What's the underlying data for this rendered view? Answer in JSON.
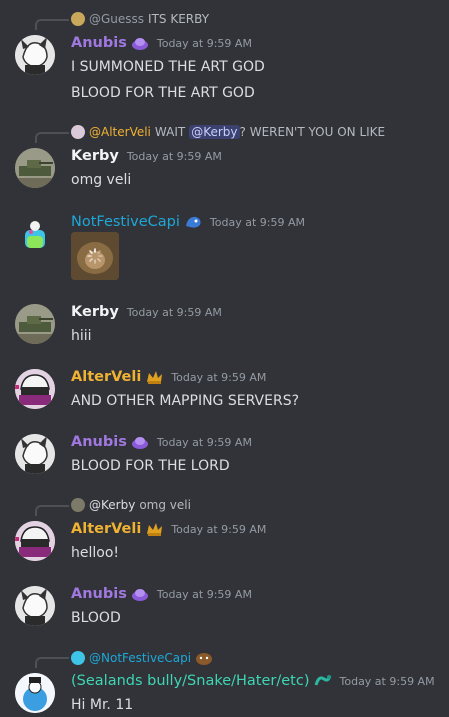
{
  "messages": [
    {
      "reply_name": "@Guesss",
      "reply_text": "ITS KERBY",
      "author": "Anubis",
      "author_color": "#a078e0",
      "timestamp": "Today at 9:59 AM",
      "lines": [
        "I SUMMONED THE ART GOD",
        "BLOOD FOR THE ART GOD"
      ]
    },
    {
      "reply_name": "@AlterVeli",
      "reply_text_before": "WAIT",
      "reply_mention": "@Kerby",
      "reply_text_after": "? WEREN'T YOU ON LIKE",
      "author": "Kerby",
      "author_color": "#f2f3f5",
      "timestamp": "Today at 9:59 AM",
      "lines": [
        "omg veli"
      ]
    },
    {
      "author": "NotFestiveCapi",
      "author_color": "#1ea7d8",
      "timestamp": "Today at 9:59 AM"
    },
    {
      "author": "Kerby",
      "author_color": "#f2f3f5",
      "timestamp": "Today at 9:59 AM",
      "lines": [
        "hiii"
      ]
    },
    {
      "author": "AlterVeli",
      "author_color": "#f0b232",
      "timestamp": "Today at 9:59 AM",
      "lines": [
        "AND OTHER MAPPING SERVERS?"
      ]
    },
    {
      "author": "Anubis",
      "author_color": "#a078e0",
      "timestamp": "Today at 9:59 AM",
      "lines": [
        "BLOOD FOR THE LORD"
      ]
    },
    {
      "reply_name": "@Kerby",
      "reply_text": "omg veli",
      "author": "AlterVeli",
      "author_color": "#f0b232",
      "timestamp": "Today at 9:59 AM",
      "lines": [
        "helloo!"
      ]
    },
    {
      "author": "Anubis",
      "author_color": "#a078e0",
      "timestamp": "Today at 9:59 AM",
      "lines": [
        "BLOOD"
      ]
    },
    {
      "reply_name": "@NotFestiveCapi",
      "author": "(Sealands bully/Snake/Hater/etc)",
      "author_color": "#3ed6b4",
      "timestamp": "Today at 9:59 AM",
      "lines": [
        "Hi Mr. 11"
      ]
    }
  ],
  "icons": {
    "anubis_badge": "purple-orb-icon",
    "capi_badge": "blue-dragon-icon",
    "alter_badge": "gold-crown-icon",
    "snake_badge": "teal-snake-icon",
    "image_loading": "loading-spinner-icon"
  }
}
